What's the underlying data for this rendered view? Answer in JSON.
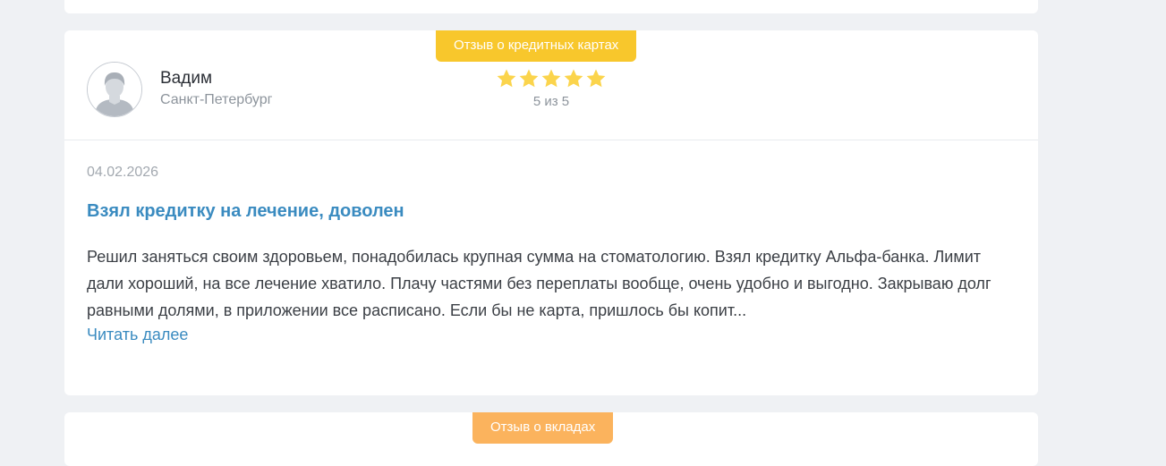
{
  "review": {
    "tag": "Отзыв о кредитных картах",
    "author": {
      "name": "Вадим",
      "city": "Санкт-Петербург",
      "avatar_icon": "user-avatar-icon"
    },
    "rating": {
      "value": 5,
      "max": 5,
      "text": "5 из 5",
      "star_color": "#fbd44c"
    },
    "date": "04.02.2026",
    "title": "Взял кредитку на лечение, доволен",
    "body": "Решил заняться своим здоровьем, понадобилась крупная сумма на стоматологию. Взял кредитку Альфа-банка. Лимит дали хороший, на все лечение хватило. Плачу частями без переплаты вообще, очень удобно и выгодно. Закрываю долг равными долями, в приложении все расписано. Если бы не карта, пришлось бы копит...",
    "read_more": "Читать далее"
  },
  "next_review": {
    "tag": "Отзыв о вкладах"
  },
  "colors": {
    "background": "#eff1f4",
    "card": "#ffffff",
    "tag_credit": "#f8c72c",
    "tag_deposit": "#fbb35d",
    "link": "#3a8bc0"
  }
}
